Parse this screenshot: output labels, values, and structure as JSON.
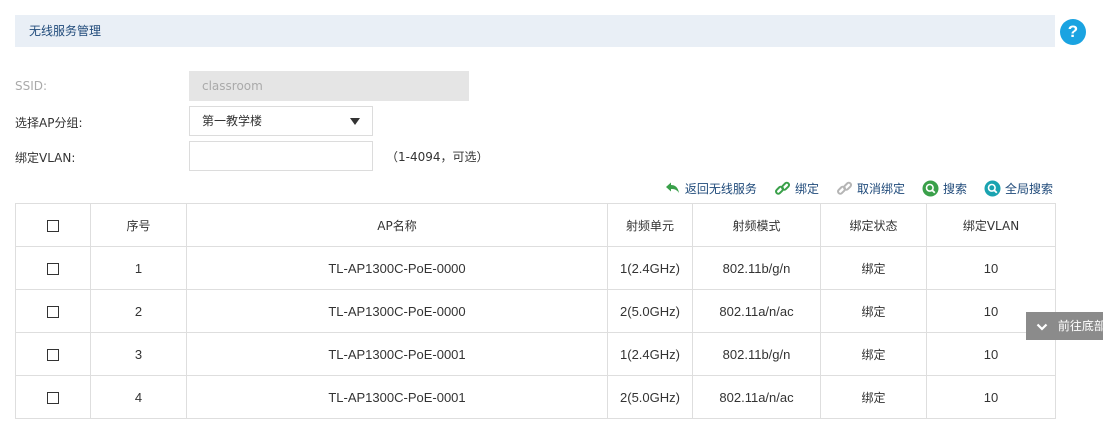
{
  "header": {
    "title": "无线服务管理",
    "help_icon": "?"
  },
  "form": {
    "ssid_label": "SSID:",
    "ssid_value": "classroom",
    "group_label": "选择AP分组:",
    "group_value": "第一教学楼",
    "vlan_label": "绑定VLAN:",
    "vlan_value": "",
    "vlan_hint": "（1-4094，可选）"
  },
  "toolbar": {
    "back_label": "返回无线服务",
    "bind_label": "绑定",
    "unbind_label": "取消绑定",
    "search_label": "搜索",
    "global_search_label": "全局搜索"
  },
  "table": {
    "headers": [
      "",
      "序号",
      "AP名称",
      "射频单元",
      "射频模式",
      "绑定状态",
      "绑定VLAN"
    ],
    "rows": [
      {
        "index": "1",
        "ap": "TL-AP1300C-PoE-0000",
        "radio": "1(2.4GHz)",
        "mode": "802.11b/g/n",
        "status": "绑定",
        "vlan": "10"
      },
      {
        "index": "2",
        "ap": "TL-AP1300C-PoE-0000",
        "radio": "2(5.0GHz)",
        "mode": "802.11a/n/ac",
        "status": "绑定",
        "vlan": "10"
      },
      {
        "index": "3",
        "ap": "TL-AP1300C-PoE-0001",
        "radio": "1(2.4GHz)",
        "mode": "802.11b/g/n",
        "status": "绑定",
        "vlan": "10"
      },
      {
        "index": "4",
        "ap": "TL-AP1300C-PoE-0001",
        "radio": "2(5.0GHz)",
        "mode": "802.11a/n/ac",
        "status": "绑定",
        "vlan": "10"
      }
    ]
  },
  "float": {
    "to_bottom_label": "前往底部"
  },
  "colors": {
    "accent": "#1aa3e1",
    "link": "#1f4a7a",
    "header_bg": "#e9eff6",
    "green": "#3aa04a"
  }
}
